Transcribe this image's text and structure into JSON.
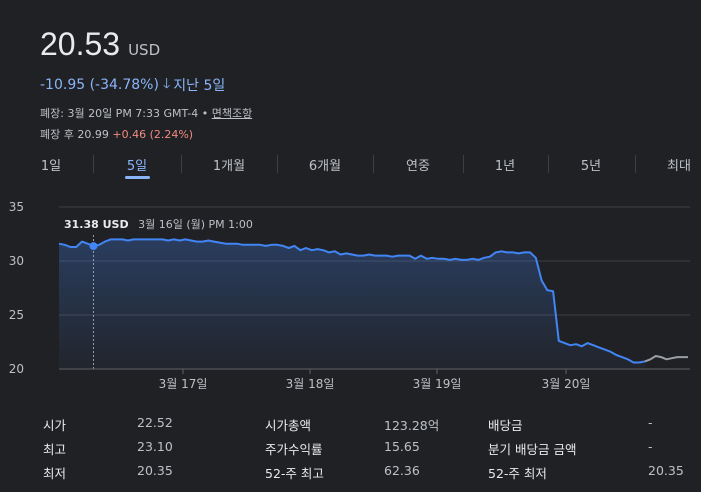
{
  "quote": {
    "price": "20.53",
    "currency": "USD",
    "change": "-10.95 (-34.78%)",
    "period": "지난 5일"
  },
  "meta": {
    "close_label": "폐장:",
    "close_time": "3월 20일 PM 7:33 GMT-4",
    "separator": "•",
    "disclaimer_link": "면책조항",
    "after_hours_label": "폐장 후",
    "after_hours_price": "20.99",
    "after_hours_change": "+0.46 (2.24%)"
  },
  "tabs": [
    "1일",
    "5일",
    "1개월",
    "6개월",
    "연중",
    "1년",
    "5년",
    "최대"
  ],
  "active_tab": "5일",
  "tooltip": {
    "price": "31.38 USD",
    "time": "3월 16일 (월) PM 1:00"
  },
  "colors": {
    "line": "#4285f4",
    "line_after_hours": "#9aa0a6",
    "accent": "#8ab4f8",
    "positive": "#f28b82"
  },
  "chart_data": {
    "type": "line",
    "ylim": [
      20,
      35
    ],
    "yticks": [
      35,
      30,
      25,
      20
    ],
    "xtick_labels": [
      "3월 17일",
      "3월 18일",
      "3월 19일",
      "3월 20일"
    ],
    "grid": true,
    "series": [
      {
        "values": [
          31.6,
          31.5,
          31.3,
          31.3,
          31.8,
          31.6,
          31.38,
          31.5,
          31.8,
          32.0,
          32.0,
          32.0,
          31.9,
          32.0,
          32.0,
          32.0,
          32.0,
          32.0,
          32.0,
          31.9,
          32.0,
          31.9,
          32.0,
          31.9,
          31.8,
          31.8,
          31.9,
          31.8,
          31.7,
          31.6,
          31.6,
          31.6,
          31.5,
          31.5,
          31.5,
          31.5,
          31.4,
          31.5,
          31.5,
          31.4,
          31.2,
          31.4,
          31.0,
          31.2,
          31.0,
          31.1,
          31.0,
          30.8,
          30.9,
          30.6,
          30.7,
          30.6,
          30.5,
          30.5,
          30.6,
          30.5,
          30.5,
          30.5,
          30.4,
          30.5,
          30.5,
          30.5,
          30.2,
          30.5,
          30.2,
          30.3,
          30.2,
          30.2,
          30.1,
          30.2,
          30.1,
          30.1,
          30.2,
          30.1,
          30.3,
          30.4,
          30.8,
          30.9,
          30.8,
          30.8,
          30.7,
          30.8,
          30.8,
          30.3,
          28.2,
          27.3,
          27.2,
          22.6,
          22.4,
          22.2,
          22.3,
          22.1,
          22.4,
          22.2,
          22.0,
          21.8,
          21.6,
          21.3,
          21.1,
          20.9,
          20.6,
          20.6,
          20.7
        ]
      },
      {
        "values": [
          20.7,
          20.9,
          21.2,
          21.1,
          20.9,
          21.0,
          21.1,
          21.1,
          21.1
        ]
      }
    ]
  },
  "stats": [
    {
      "label": "시가",
      "value": "22.52"
    },
    {
      "label": "최고",
      "value": "23.10"
    },
    {
      "label": "최저",
      "value": "20.35"
    },
    {
      "label": "시가총액",
      "value": "123.28억"
    },
    {
      "label": "주가수익률",
      "value": "15.65"
    },
    {
      "label": "52-주 최고",
      "value": "62.36"
    },
    {
      "label": "배당금",
      "value": "-"
    },
    {
      "label": "분기 배당금 금액",
      "value": "-"
    },
    {
      "label": "52-주 최저",
      "value": "20.35"
    }
  ]
}
